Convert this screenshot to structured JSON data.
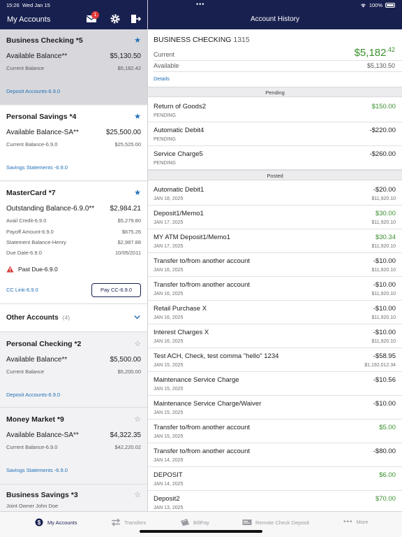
{
  "status": {
    "time": "15:26",
    "date": "Wed Jan 15",
    "battery": "100%"
  },
  "left_header": {
    "title": "My Accounts",
    "badge": "1"
  },
  "right_header": {
    "title": "Account History"
  },
  "accounts": {
    "business_checking": {
      "name": "Business Checking *5",
      "avail_label": "Available Balance**",
      "avail_value": "$5,130.50",
      "current_label": "Current Balance",
      "current_value": "$5,182.42",
      "link": "Deposit Accounts-6.9.0"
    },
    "personal_savings": {
      "name": "Personal Savings *4",
      "avail_label": "Available Balance-SA**",
      "avail_value": "$25,500.00",
      "current_label": "Current Balance-6.9.0",
      "current_value": "$25,525.00",
      "link": "Savings Statements -6.9.0"
    },
    "mastercard": {
      "name": "MasterCard *7",
      "out_label": "Outstanding Balance-6.9.0**",
      "out_value": "$2,984.21",
      "rows": [
        {
          "label": "Avail Credit-6.9.0",
          "value": "$5,279.80"
        },
        {
          "label": "Payoff Amount-6.9.0",
          "value": "$675.26"
        },
        {
          "label": "Statement Balance-Henry",
          "value": "$2,987.88"
        },
        {
          "label": "Due Date-6.9.0",
          "value": "10/05/2011"
        }
      ],
      "past_due": "Past Due-6.9.0",
      "link": "CC Link-6.9.0",
      "pay_button": "Pay CC-6.9.0"
    },
    "other": {
      "label": "Other Accounts",
      "count": "(4)"
    },
    "personal_checking": {
      "name": "Personal Checking *2",
      "avail_label": "Available Balance**",
      "avail_value": "$5,500.00",
      "current_label": "Current Balance",
      "current_value": "$5,200.00",
      "link": "Deposit Accounts-6.9.0"
    },
    "money_market": {
      "name": "Money Market *9",
      "avail_label": "Available Balance-SA**",
      "avail_value": "$4,322.35",
      "current_label": "Current Balance-6.9.0",
      "current_value": "$42,220.02",
      "link": "Savings Statements -6.9.0"
    },
    "business_savings": {
      "name": "Business Savings *3",
      "sub": "Joint Owner John Doe"
    }
  },
  "history": {
    "account_name": "BUSINESS CHECKING",
    "account_num": "1315",
    "current_label": "Current",
    "current_main": "$5,182",
    "current_cents": ".42",
    "available_label": "Available",
    "available_value": "$5,130.50",
    "details": "Details",
    "pending_header": "Pending",
    "posted_header": "Posted",
    "pending": [
      {
        "desc": "Return of Goods2",
        "sub": "PENDING",
        "amount": "$150.00",
        "positive": true
      },
      {
        "desc": "Automatic Debit4",
        "sub": "PENDING",
        "amount": "-$220.00",
        "positive": false
      },
      {
        "desc": "Service Charge5",
        "sub": "PENDING",
        "amount": "-$260.00",
        "positive": false
      }
    ],
    "posted": [
      {
        "desc": "Automatic Debit1",
        "sub": "JAN 18, 2025",
        "amount": "-$20.00",
        "balance": "$11,920.10",
        "positive": false
      },
      {
        "desc": "Deposit1/Memo1",
        "sub": "JAN 17, 2025",
        "amount": "$30.00",
        "balance": "$11,920.10",
        "positive": true
      },
      {
        "desc": "MY ATM Deposit1/Memo1",
        "sub": "JAN 17, 2025",
        "amount": "$30.34",
        "balance": "$11,920.10",
        "positive": true
      },
      {
        "desc": "Transfer to/from another account",
        "sub": "JAN 16, 2025",
        "amount": "-$10.00",
        "balance": "$11,920.10",
        "positive": false
      },
      {
        "desc": "Transfer to/from another account",
        "sub": "JAN 16, 2025",
        "amount": "-$10.00",
        "balance": "$11,920.10",
        "positive": false
      },
      {
        "desc": "Retail Purchase X",
        "sub": "JAN 16, 2025",
        "amount": "-$10.00",
        "balance": "$11,920.10",
        "positive": false
      },
      {
        "desc": "Interest Charges X",
        "sub": "JAN 16, 2025",
        "amount": "-$10.00",
        "balance": "$11,920.10",
        "positive": false
      },
      {
        "desc": "Test ACH, Check, test comma \"hello\" 1234",
        "sub": "JAN 15, 2025",
        "amount": "-$58.95",
        "balance": "$1,192,012.34",
        "positive": false
      },
      {
        "desc": "Maintenance Service Charge",
        "sub": "JAN 15, 2025",
        "amount": "-$10.56",
        "balance": "",
        "positive": false
      },
      {
        "desc": "Maintenance Service Charge/Waiver",
        "sub": "JAN 15, 2025",
        "amount": "-$10.00",
        "balance": "",
        "positive": false
      },
      {
        "desc": "Transfer to/from another account",
        "sub": "JAN 15, 2025",
        "amount": "$5.00",
        "balance": "",
        "positive": true
      },
      {
        "desc": "Transfer to/from another account",
        "sub": "JAN 14, 2025",
        "amount": "-$80.00",
        "balance": "",
        "positive": false
      },
      {
        "desc": "DEPOSIT",
        "sub": "JAN 14, 2025",
        "amount": "$6.00",
        "balance": "",
        "positive": true
      },
      {
        "desc": "Deposit2",
        "sub": "JAN 13, 2025",
        "amount": "$70.00",
        "balance": "",
        "positive": true
      }
    ]
  },
  "tabs": [
    {
      "label": "My Accounts",
      "icon": "dollar-circle-icon"
    },
    {
      "label": "Transfers",
      "icon": "transfer-arrows-icon"
    },
    {
      "label": "BillPay",
      "icon": "billpay-icon"
    },
    {
      "label": "Remote Check Deposit",
      "icon": "check-icon"
    },
    {
      "label": "More",
      "icon": "more-dots-icon"
    }
  ],
  "colors": {
    "header": "#18204f",
    "link": "#1f6fb5",
    "positive": "#3a8f2e",
    "warning": "#e23b3b"
  }
}
